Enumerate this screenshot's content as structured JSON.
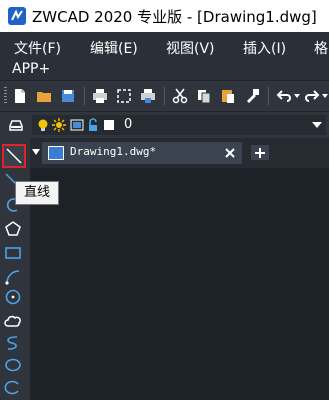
{
  "window": {
    "title": "ZWCAD 2020 专业版 - [Drawing1.dwg]"
  },
  "menu": {
    "items": [
      {
        "label": "文件(F)"
      },
      {
        "label": "编辑(E)"
      },
      {
        "label": "视图(V)"
      },
      {
        "label": "插入(I)"
      },
      {
        "label": "格"
      },
      {
        "label": "APP+"
      }
    ]
  },
  "layer": {
    "current": "0"
  },
  "doc_tab": {
    "label": "Drawing1.dwg*"
  },
  "tooltip": {
    "text": "直线"
  },
  "colors": {
    "accent": "#e0222a",
    "tab": "#3c4350",
    "background": "#1e2229"
  }
}
